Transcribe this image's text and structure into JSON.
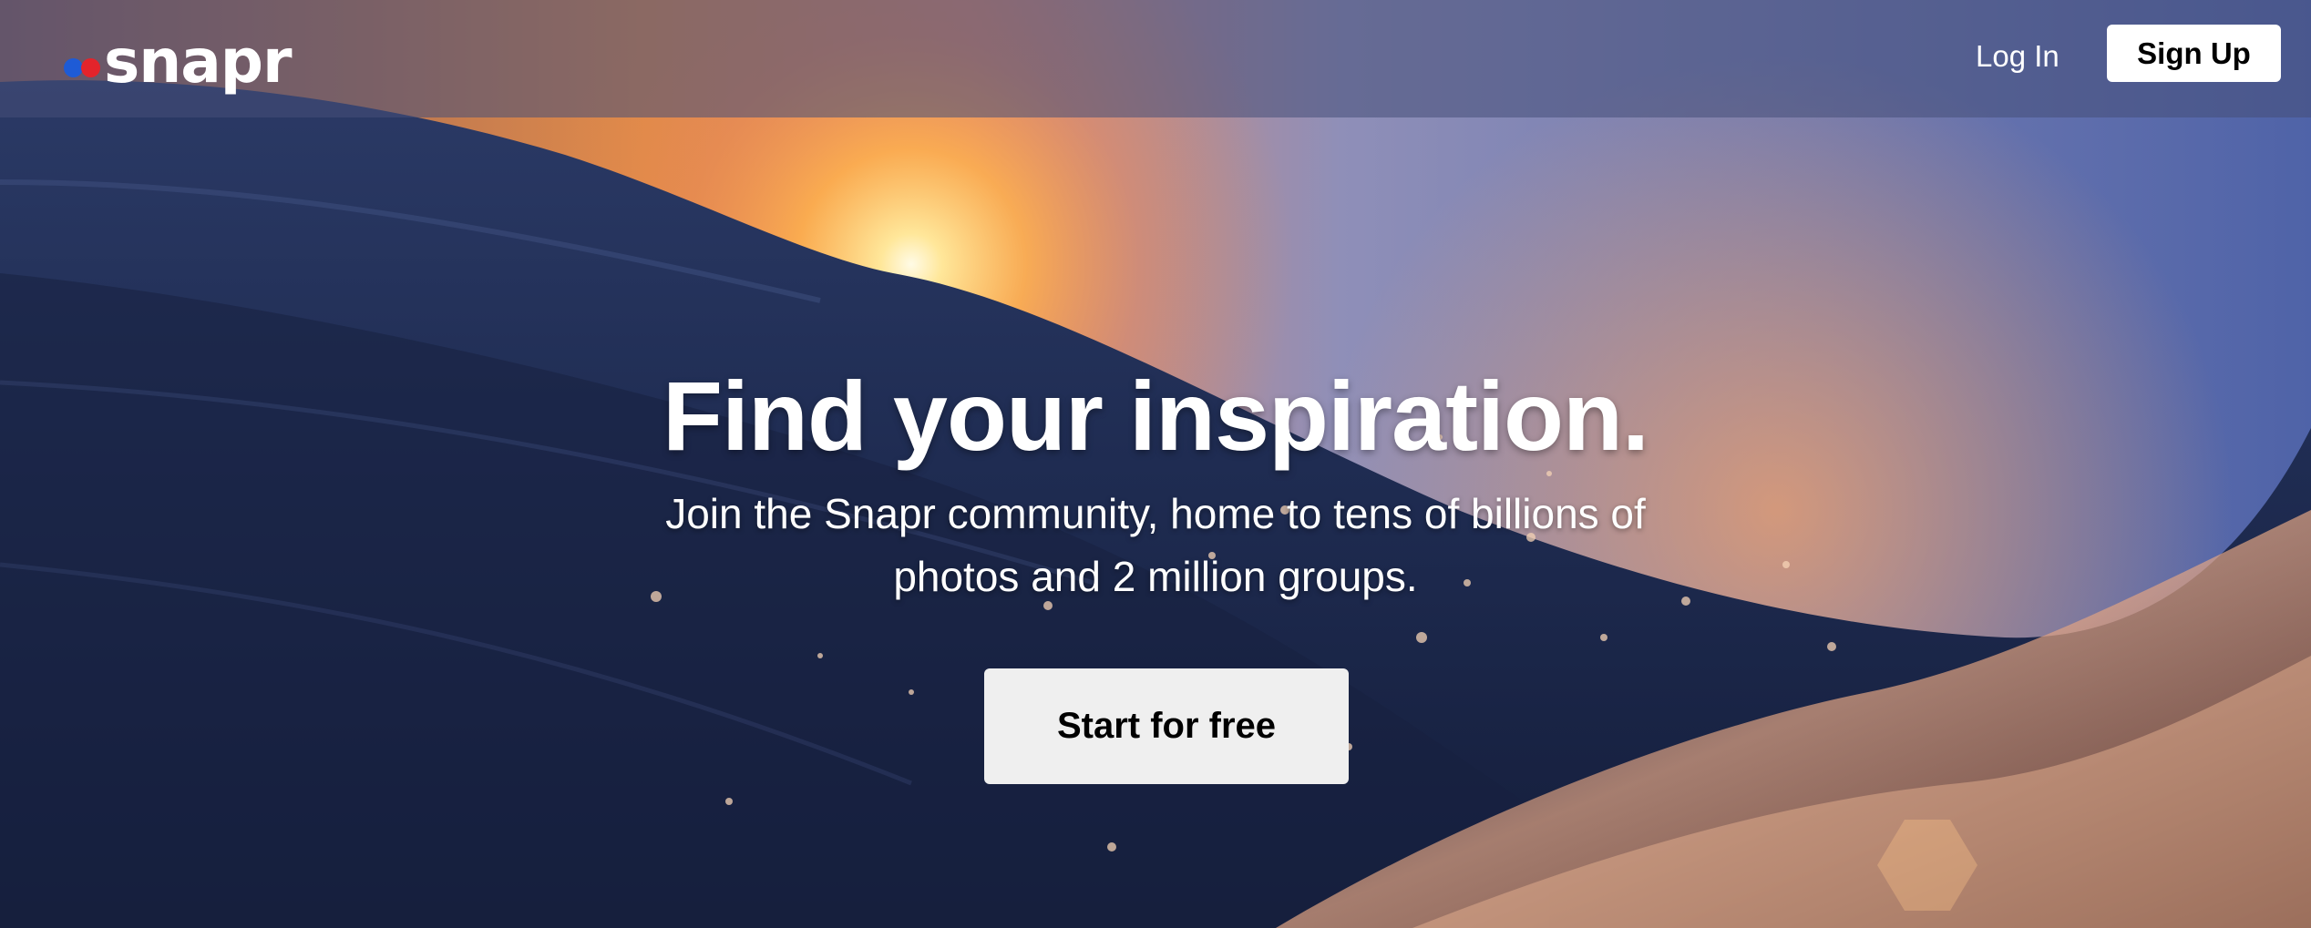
{
  "navbar": {
    "logo_text": "snapr",
    "login_label": "Log In",
    "signup_label": "Sign Up"
  },
  "hero": {
    "title": "Find your inspiration.",
    "subtitle": "Join the Snapr community, home to tens of billions of photos and 2 million groups.",
    "cta_label": "Start for free"
  },
  "colors": {
    "logo_dot_1": "#1e5bd6",
    "logo_dot_2": "#e3242b",
    "button_bg": "#ffffff",
    "cta_bg": "#efefef"
  }
}
